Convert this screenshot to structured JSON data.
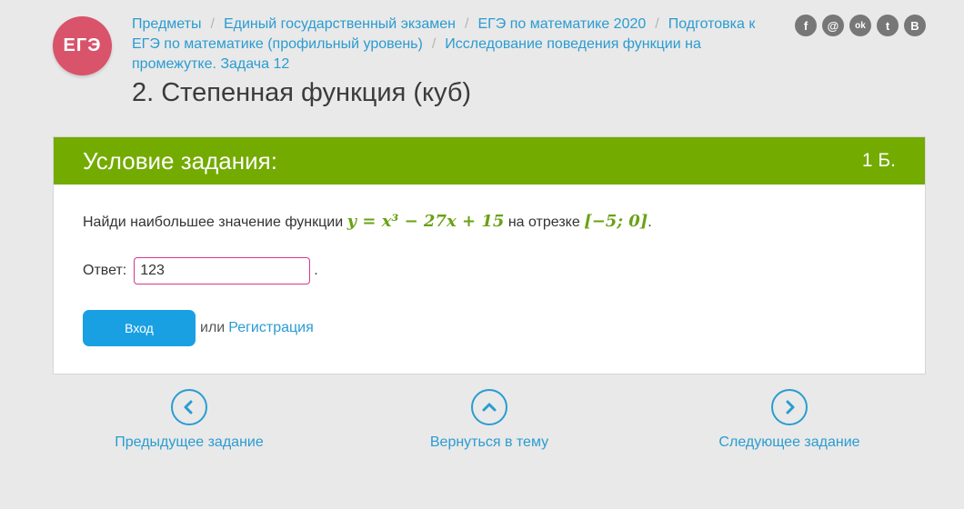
{
  "logo": {
    "text": "ЕГЭ"
  },
  "breadcrumbs": [
    "Предметы",
    "Единый государственный экзамен",
    "ЕГЭ по математике 2020",
    "Подготовка к ЕГЭ по математике (профильный уровень)",
    "Исследование поведения функции на промежутке. Задача 12"
  ],
  "page": {
    "title": "2. Степенная функция (куб)"
  },
  "social": [
    "facebook-icon",
    "mail-icon",
    "odnoklassniki-icon",
    "twitter-icon",
    "vk-icon"
  ],
  "social_glyphs": {
    "facebook": "f",
    "mail": "@",
    "ok": "ok",
    "twitter": "t",
    "vk": "B"
  },
  "task": {
    "header": "Условие задания:",
    "points": "1 Б.",
    "text_before": "Найди наибольшее значение функции",
    "formula": "y = x³ − 27x + 15",
    "text_middle": "на отрезке",
    "interval": "[−5; 0]",
    "text_end": ".",
    "answer_label": "Ответ:",
    "answer_value": "123",
    "answer_suffix": ".",
    "login_label": "Вход",
    "or_text": "или",
    "register_label": "Регистрация"
  },
  "navigation": {
    "prev": "Предыдущее задание",
    "up": "Вернуться в тему",
    "next": "Следующее задание"
  },
  "colors": {
    "accent_green": "#73ab00",
    "link_blue": "#2a9cd1",
    "button_blue": "#19a0e3",
    "input_border": "#d2388d",
    "logo": "#d9536a"
  }
}
